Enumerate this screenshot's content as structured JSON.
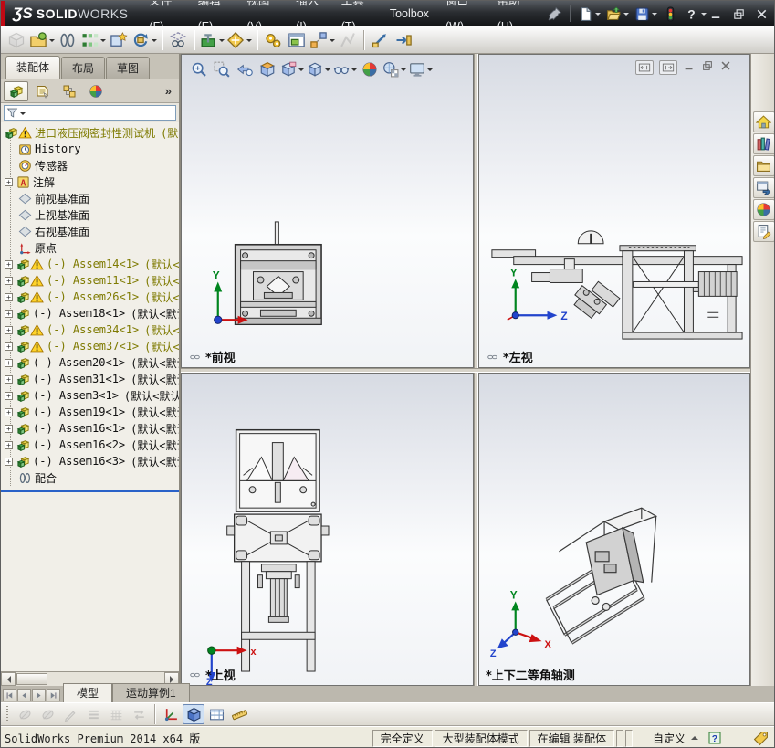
{
  "colors": {
    "accent_red": "#c00914",
    "warning_text_olive": "#7e7a00",
    "divider_blue": "#2a62c8"
  },
  "titlebar": {
    "logo_glyph": "ƷS",
    "logo_bold": "SOLID",
    "logo_light": "WORKS",
    "menus": [
      {
        "id": "file",
        "label": "文件(F)"
      },
      {
        "id": "edit",
        "label": "编辑(E)"
      },
      {
        "id": "view",
        "label": "视图(V)"
      },
      {
        "id": "insert",
        "label": "插入(I)"
      },
      {
        "id": "tools",
        "label": "工具(T)"
      },
      {
        "id": "toolbox",
        "label": "Toolbox"
      },
      {
        "id": "window",
        "label": "窗口(W)"
      },
      {
        "id": "help",
        "label": "帮助(H)"
      }
    ],
    "quick_icons": [
      {
        "name": "pin"
      },
      {
        "sep": true
      },
      {
        "name": "new-document",
        "dd": true
      },
      {
        "name": "open-document",
        "dd": true
      },
      {
        "name": "save",
        "dd": true
      },
      {
        "name": "traffic-light"
      },
      {
        "name": "help",
        "dd": true
      }
    ]
  },
  "main_toolbar": [
    {
      "name": "edit-component",
      "disabled": true
    },
    {
      "name": "insert-components",
      "dd": true
    },
    {
      "name": "mate"
    },
    {
      "name": "linear-component-pattern",
      "dd": true
    },
    {
      "name": "smart-fasteners"
    },
    {
      "name": "move-component",
      "dd": true
    },
    {
      "sep": true
    },
    {
      "name": "show-hidden-components"
    },
    {
      "sep": true
    },
    {
      "name": "assembly-features",
      "dd": true
    },
    {
      "name": "reference-geometry",
      "dd": true
    },
    {
      "sep": true
    },
    {
      "name": "new-motion-study"
    },
    {
      "name": "assembly-window"
    },
    {
      "name": "exploded-view",
      "dd": true
    },
    {
      "name": "explode-line-sketch",
      "disabled": true
    },
    {
      "sep": true
    },
    {
      "name": "instant-3d"
    },
    {
      "name": "speedpak"
    }
  ],
  "command_tabs": [
    {
      "id": "assembly",
      "label": "装配体",
      "active": true
    },
    {
      "id": "layout",
      "label": "布局",
      "active": false
    },
    {
      "id": "sketch",
      "label": "草图",
      "active": false
    }
  ],
  "featuremanager": {
    "tabs": [
      {
        "name": "featuremanager-tree",
        "active": true
      },
      {
        "name": "propertymanager",
        "active": false
      },
      {
        "name": "configurationmanager",
        "active": false
      },
      {
        "name": "displaymanager",
        "active": false
      }
    ],
    "expand_chevron": "»",
    "tree": [
      {
        "icon": "assembly",
        "warning": true,
        "root": true,
        "olive": true,
        "label": "进口液压阀密封性测试机",
        "suffix": "(默"
      },
      {
        "icon": "history",
        "label": "History"
      },
      {
        "icon": "sensors",
        "label": "传感器"
      },
      {
        "icon": "annotations",
        "plus": true,
        "label": "注解"
      },
      {
        "icon": "plane",
        "label": "前视基准面"
      },
      {
        "icon": "plane",
        "label": "上视基准面"
      },
      {
        "icon": "plane",
        "label": "右视基准面"
      },
      {
        "icon": "origin",
        "label": "原点"
      },
      {
        "icon": "assembly",
        "warning": true,
        "plus": true,
        "olive": true,
        "label": "(-) Assem14<1>",
        "suffix": "(默认<默"
      },
      {
        "icon": "assembly",
        "warning": true,
        "plus": true,
        "olive": true,
        "label": "(-) Assem11<1>",
        "suffix": "(默认<默"
      },
      {
        "icon": "assembly",
        "warning": true,
        "plus": true,
        "olive": true,
        "label": "(-) Assem26<1>",
        "suffix": "(默认<默"
      },
      {
        "icon": "assembly",
        "plus": true,
        "label": "(-) Assem18<1>",
        "suffix": "(默认<默认_"
      },
      {
        "icon": "assembly",
        "warning": true,
        "plus": true,
        "olive": true,
        "label": "(-) Assem34<1>",
        "suffix": "(默认<默"
      },
      {
        "icon": "assembly",
        "warning": true,
        "plus": true,
        "olive": true,
        "label": "(-) Assem37<1>",
        "suffix": "(默认<默"
      },
      {
        "icon": "assembly",
        "plus": true,
        "label": "(-) Assem20<1>",
        "suffix": "(默认<默认_"
      },
      {
        "icon": "assembly",
        "plus": true,
        "label": "(-) Assem31<1>",
        "suffix": "(默认<默认_"
      },
      {
        "icon": "assembly",
        "plus": true,
        "label": "(-) Assem3<1>",
        "suffix": "(默认<默认_"
      },
      {
        "icon": "assembly",
        "plus": true,
        "label": "(-) Assem19<1>",
        "suffix": "(默认<默认_"
      },
      {
        "icon": "assembly",
        "plus": true,
        "label": "(-) Assem16<1>",
        "suffix": "(默认<默认_"
      },
      {
        "icon": "assembly",
        "plus": true,
        "label": "(-) Assem16<2>",
        "suffix": "(默认<默认_"
      },
      {
        "icon": "assembly",
        "plus": true,
        "label": "(-) Assem16<3>",
        "suffix": "(默认<默认_"
      },
      {
        "icon": "mates",
        "label": "配合"
      }
    ]
  },
  "hud_toolbar": [
    {
      "name": "zoom-to-fit"
    },
    {
      "name": "zoom-to-area"
    },
    {
      "name": "previous-view"
    },
    {
      "name": "section-view"
    },
    {
      "name": "view-orientation",
      "dd": true
    },
    {
      "name": "display-style",
      "dd": true
    },
    {
      "name": "hide-show-items",
      "dd": true
    },
    {
      "name": "edit-appearance"
    },
    {
      "name": "apply-scene",
      "dd": true
    },
    {
      "name": "view-settings",
      "dd": true
    }
  ],
  "doc_window_controls": [
    {
      "name": "split-left"
    },
    {
      "name": "split-right"
    },
    {
      "name": "minimize-doc"
    },
    {
      "name": "restore-doc"
    },
    {
      "name": "close-doc"
    }
  ],
  "viewports": [
    {
      "id": "front",
      "label": "*前视",
      "chain": true
    },
    {
      "id": "left",
      "label": "*左视",
      "chain": true
    },
    {
      "id": "top",
      "label": "*上视",
      "chain": true
    },
    {
      "id": "dimetric",
      "label": "*上下二等角轴测",
      "chain": false
    }
  ],
  "taskpane": [
    {
      "name": "home"
    },
    {
      "name": "design-library"
    },
    {
      "name": "file-explorer"
    },
    {
      "name": "view-palette"
    },
    {
      "name": "appearances"
    },
    {
      "name": "custom-properties"
    }
  ],
  "motion_bar": {
    "nav": [
      {
        "name": "nav-first"
      },
      {
        "name": "nav-previous"
      },
      {
        "name": "nav-next"
      },
      {
        "name": "nav-last"
      }
    ],
    "tabs": [
      {
        "id": "model",
        "label": "模型",
        "active": true
      },
      {
        "id": "motion-study-1",
        "label": "运动算例1",
        "active": false
      }
    ]
  },
  "bottom_toolbar": [
    {
      "name": "filter-animation",
      "disabled": true
    },
    {
      "name": "filter-driving",
      "disabled": true
    },
    {
      "name": "filter-results",
      "disabled": true
    },
    {
      "name": "display-lines",
      "disabled": true
    },
    {
      "name": "grid-snap",
      "disabled": true
    },
    {
      "name": "swap-views",
      "disabled": true
    },
    {
      "sep": true
    },
    {
      "name": "coordinate-axes"
    },
    {
      "name": "view-cube",
      "active": true
    },
    {
      "name": "grid-table"
    },
    {
      "name": "measure-ruler"
    }
  ],
  "statusbar": {
    "left_text": "SolidWorks Premium 2014 x64 版",
    "cells": [
      "完全定义",
      "大型装配体模式",
      "在编辑 装配体"
    ],
    "mini_cells": 2,
    "custom_label": "自定义"
  }
}
